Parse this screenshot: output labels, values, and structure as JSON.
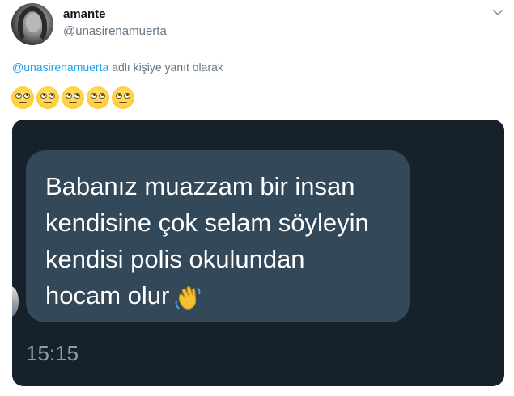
{
  "user": {
    "display_name": "amante",
    "handle": "@unasirenamuerta"
  },
  "reply": {
    "mention": "@unasirenamuerta",
    "text": " adlı kişiye yanıt olarak"
  },
  "emojis": [
    "face-with-rolling-eyes",
    "face-with-rolling-eyes",
    "face-with-rolling-eyes",
    "face-with-rolling-eyes",
    "face-with-rolling-eyes"
  ],
  "media": {
    "message_lines": [
      "Babanız muazzam bir insan",
      "kendisine çok selam söyleyin",
      "kendisi polis okulundan",
      "hocam olur"
    ],
    "message_emoji": "waving-hand-icon",
    "time": "15:15"
  },
  "colors": {
    "mention": "#1da1f2",
    "media_background": "#17212b",
    "bubble": "#334858"
  }
}
